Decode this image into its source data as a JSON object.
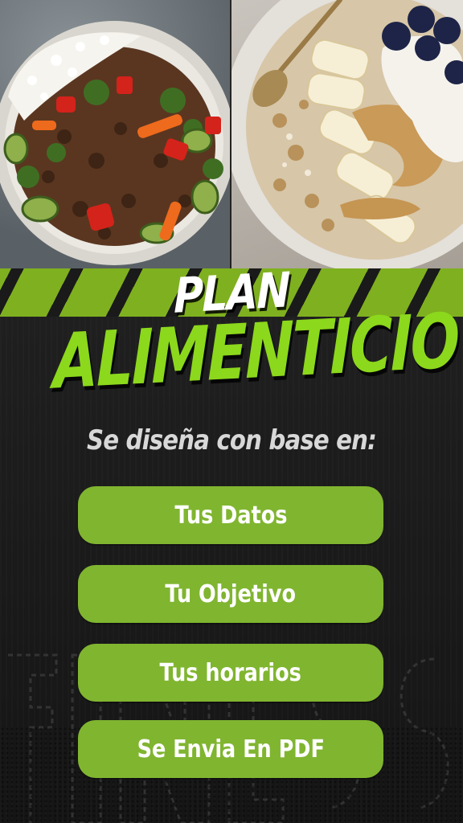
{
  "header": {
    "title_line1": "PLAN",
    "title_line2": "ALIMENTICIO"
  },
  "subtitle": "Se diseña con base en:",
  "buttons": [
    {
      "label": "Tus Datos"
    },
    {
      "label": "Tu Objetivo"
    },
    {
      "label": "Tus horarios"
    },
    {
      "label": "Se Envia En PDF"
    }
  ],
  "images": {
    "left": "stir-fry-bowl-photo",
    "right": "oatmeal-banana-bowl-photo"
  },
  "colors": {
    "accent_green": "#8cd81c",
    "button_green": "#80b530",
    "background": "#1e1e1e"
  }
}
